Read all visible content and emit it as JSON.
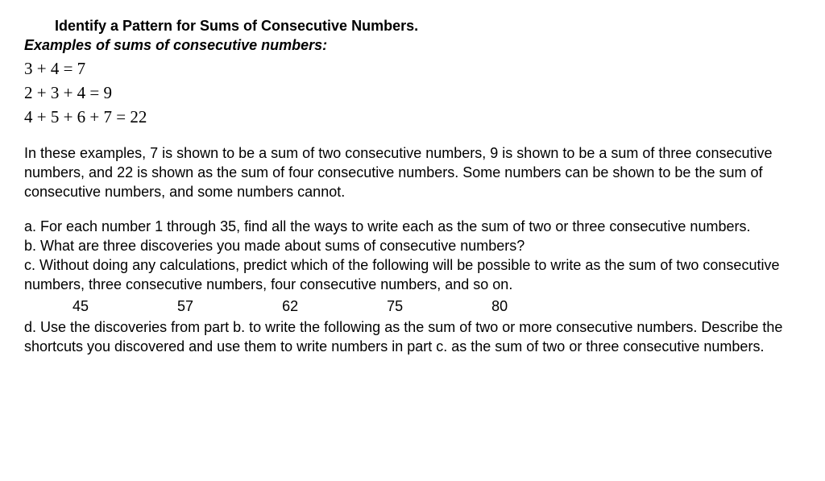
{
  "title": "Identify a Pattern for Sums of Consecutive Numbers.",
  "subtitle": "Examples of sums of consecutive numbers:",
  "equations": {
    "eq1": "3 + 4 = 7",
    "eq2": "2 + 3 + 4 = 9",
    "eq3": "4 + 5 + 6 + 7 = 22"
  },
  "explanation": "In these examples, 7 is shown to be a sum of two consecutive numbers, 9 is shown to be a sum of three consecutive numbers, and 22 is shown as the sum of four consecutive numbers. Some numbers can be shown to be the sum of consecutive numbers, and some numbers cannot.",
  "questions": {
    "a": "a.  For each number 1 through 35, find all the ways to write each as the sum of two or three consecutive numbers.",
    "b": "b.  What are three discoveries you made about sums of consecutive numbers?",
    "c": "c.  Without doing any calculations, predict which of the following will be possible to write as the sum of two consecutive numbers, three consecutive numbers, four consecutive numbers, and so on.",
    "d": "d.   Use the discoveries from part b. to write the following as the sum of two or more consecutive numbers.  Describe the shortcuts you discovered and use them to write numbers in part c. as the sum of two or three consecutive numbers."
  },
  "number_list": {
    "n1": "45",
    "n2": "57",
    "n3": "62",
    "n4": "75",
    "n5": "80"
  }
}
